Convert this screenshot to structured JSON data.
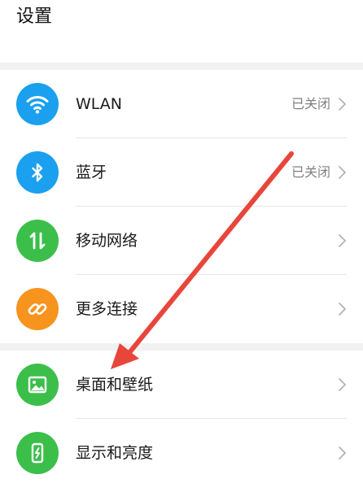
{
  "header": {
    "title": "设置"
  },
  "settings": {
    "wlan": {
      "label": "WLAN",
      "status": "已关闭",
      "icon": "wifi-icon",
      "color": "#1aa0ee"
    },
    "bluetooth": {
      "label": "蓝牙",
      "status": "已关闭",
      "icon": "bluetooth-icon",
      "color": "#1aa0ee"
    },
    "mobile_network": {
      "label": "移动网络",
      "icon": "mobile-data-icon",
      "color": "#3bbf4a"
    },
    "more_connections": {
      "label": "更多连接",
      "icon": "link-icon",
      "color": "#f7941d"
    },
    "desktop_wallpaper": {
      "label": "桌面和壁纸",
      "icon": "wallpaper-icon",
      "color": "#3bbf4a"
    },
    "display_brightness": {
      "label": "显示和亮度",
      "icon": "display-phone-icon",
      "color": "#3bbf4a"
    }
  },
  "annotation": {
    "arrow_color": "#e8463b"
  }
}
